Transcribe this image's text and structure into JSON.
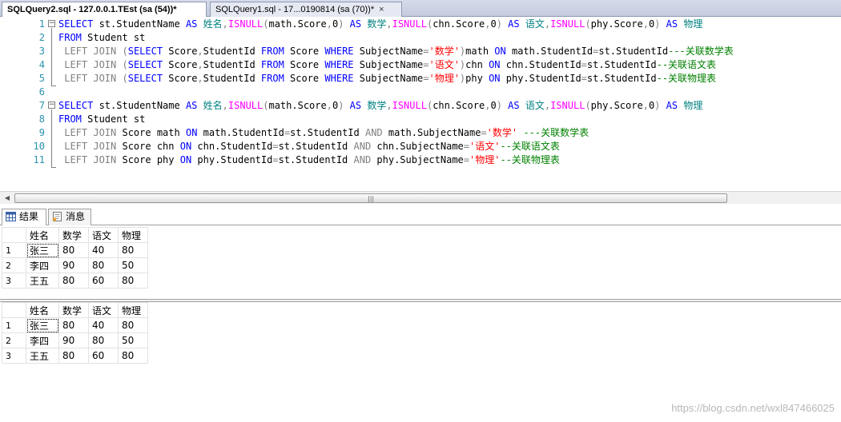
{
  "tabs": [
    {
      "label": "SQLQuery2.sql - 127.0.0.1.TEst (sa (54))*",
      "active": true
    },
    {
      "label": "SQLQuery1.sql - 17...0190814 (sa (70))*",
      "active": false
    }
  ],
  "tab_close_glyph": "×",
  "editor": {
    "line_numbers": [
      "1",
      "2",
      "3",
      "4",
      "5",
      "6",
      "7",
      "8",
      "9",
      "10",
      "11"
    ],
    "lines": [
      [
        [
          "kw",
          "SELECT "
        ],
        [
          "pl",
          "st.StudentName "
        ],
        [
          "kw",
          "AS "
        ],
        [
          "id",
          "姓名"
        ],
        [
          "op",
          ","
        ],
        [
          "fn",
          "ISNULL"
        ],
        [
          "op",
          "("
        ],
        [
          "pl",
          "math.Score"
        ],
        [
          "op",
          ","
        ],
        [
          "pl",
          "0"
        ],
        [
          "op",
          ") "
        ],
        [
          "kw",
          "AS "
        ],
        [
          "id",
          "数学"
        ],
        [
          "op",
          ","
        ],
        [
          "fn",
          "ISNULL"
        ],
        [
          "op",
          "("
        ],
        [
          "pl",
          "chn.Score"
        ],
        [
          "op",
          ","
        ],
        [
          "pl",
          "0"
        ],
        [
          "op",
          ") "
        ],
        [
          "kw",
          "AS "
        ],
        [
          "id",
          "语文"
        ],
        [
          "op",
          ","
        ],
        [
          "fn",
          "ISNULL"
        ],
        [
          "op",
          "("
        ],
        [
          "pl",
          "phy.Score"
        ],
        [
          "op",
          ","
        ],
        [
          "pl",
          "0"
        ],
        [
          "op",
          ") "
        ],
        [
          "kw",
          "AS "
        ],
        [
          "id",
          "物理"
        ]
      ],
      [
        [
          "kw",
          "FROM "
        ],
        [
          "pl",
          "Student st"
        ]
      ],
      [
        [
          "op",
          " LEFT JOIN "
        ],
        [
          "op",
          "("
        ],
        [
          "kw",
          "SELECT "
        ],
        [
          "pl",
          "Score"
        ],
        [
          "op",
          ","
        ],
        [
          "pl",
          "StudentId "
        ],
        [
          "kw",
          "FROM "
        ],
        [
          "pl",
          "Score "
        ],
        [
          "kw",
          "WHERE "
        ],
        [
          "pl",
          "SubjectName"
        ],
        [
          "op",
          "="
        ],
        [
          "str",
          "'数学'"
        ],
        [
          "op",
          ")"
        ],
        [
          "pl",
          "math "
        ],
        [
          "kw",
          "ON "
        ],
        [
          "pl",
          "math.StudentId"
        ],
        [
          "op",
          "="
        ],
        [
          "pl",
          "st.StudentId"
        ],
        [
          "cm",
          "---关联数学表"
        ]
      ],
      [
        [
          "op",
          " LEFT JOIN "
        ],
        [
          "op",
          "("
        ],
        [
          "kw",
          "SELECT "
        ],
        [
          "pl",
          "Score"
        ],
        [
          "op",
          ","
        ],
        [
          "pl",
          "StudentId "
        ],
        [
          "kw",
          "FROM "
        ],
        [
          "pl",
          "Score "
        ],
        [
          "kw",
          "WHERE "
        ],
        [
          "pl",
          "SubjectName"
        ],
        [
          "op",
          "="
        ],
        [
          "str",
          "'语文'"
        ],
        [
          "op",
          ")"
        ],
        [
          "pl",
          "chn "
        ],
        [
          "kw",
          "ON "
        ],
        [
          "pl",
          "chn.StudentId"
        ],
        [
          "op",
          "="
        ],
        [
          "pl",
          "st.StudentId"
        ],
        [
          "cm",
          "--关联语文表"
        ]
      ],
      [
        [
          "op",
          " LEFT JOIN "
        ],
        [
          "op",
          "("
        ],
        [
          "kw",
          "SELECT "
        ],
        [
          "pl",
          "Score"
        ],
        [
          "op",
          ","
        ],
        [
          "pl",
          "StudentId "
        ],
        [
          "kw",
          "FROM "
        ],
        [
          "pl",
          "Score "
        ],
        [
          "kw",
          "WHERE "
        ],
        [
          "pl",
          "SubjectName"
        ],
        [
          "op",
          "="
        ],
        [
          "str",
          "'物理'"
        ],
        [
          "op",
          ")"
        ],
        [
          "pl",
          "phy "
        ],
        [
          "kw",
          "ON "
        ],
        [
          "pl",
          "phy.StudentId"
        ],
        [
          "op",
          "="
        ],
        [
          "pl",
          "st.StudentId"
        ],
        [
          "cm",
          "--关联物理表"
        ]
      ],
      [],
      [
        [
          "kw",
          "SELECT "
        ],
        [
          "pl",
          "st.StudentName "
        ],
        [
          "kw",
          "AS "
        ],
        [
          "id",
          "姓名"
        ],
        [
          "op",
          ","
        ],
        [
          "fn",
          "ISNULL"
        ],
        [
          "op",
          "("
        ],
        [
          "pl",
          "math.Score"
        ],
        [
          "op",
          ","
        ],
        [
          "pl",
          "0"
        ],
        [
          "op",
          ") "
        ],
        [
          "kw",
          "AS "
        ],
        [
          "id",
          "数学"
        ],
        [
          "op",
          ","
        ],
        [
          "fn",
          "ISNULL"
        ],
        [
          "op",
          "("
        ],
        [
          "pl",
          "chn.Score"
        ],
        [
          "op",
          ","
        ],
        [
          "pl",
          "0"
        ],
        [
          "op",
          ") "
        ],
        [
          "kw",
          "AS "
        ],
        [
          "id",
          "语文"
        ],
        [
          "op",
          ","
        ],
        [
          "fn",
          "ISNULL"
        ],
        [
          "op",
          "("
        ],
        [
          "pl",
          "phy.Score"
        ],
        [
          "op",
          ","
        ],
        [
          "pl",
          "0"
        ],
        [
          "op",
          ") "
        ],
        [
          "kw",
          "AS "
        ],
        [
          "id",
          "物理"
        ]
      ],
      [
        [
          "kw",
          "FROM "
        ],
        [
          "pl",
          "Student st"
        ]
      ],
      [
        [
          "op",
          " LEFT JOIN "
        ],
        [
          "pl",
          "Score math "
        ],
        [
          "kw",
          "ON "
        ],
        [
          "pl",
          "math.StudentId"
        ],
        [
          "op",
          "="
        ],
        [
          "pl",
          "st.StudentId "
        ],
        [
          "op",
          "AND "
        ],
        [
          "pl",
          "math.SubjectName"
        ],
        [
          "op",
          "="
        ],
        [
          "str",
          "'数学' "
        ],
        [
          "cm",
          "---关联数学表"
        ]
      ],
      [
        [
          "op",
          " LEFT JOIN "
        ],
        [
          "pl",
          "Score chn "
        ],
        [
          "kw",
          "ON "
        ],
        [
          "pl",
          "chn.StudentId"
        ],
        [
          "op",
          "="
        ],
        [
          "pl",
          "st.StudentId "
        ],
        [
          "op",
          "AND "
        ],
        [
          "pl",
          "chn.SubjectName"
        ],
        [
          "op",
          "="
        ],
        [
          "str",
          "'语文'"
        ],
        [
          "cm",
          "--关联语文表"
        ]
      ],
      [
        [
          "op",
          " LEFT JOIN "
        ],
        [
          "pl",
          "Score phy "
        ],
        [
          "kw",
          "ON "
        ],
        [
          "pl",
          "phy.StudentId"
        ],
        [
          "op",
          "="
        ],
        [
          "pl",
          "st.StudentId "
        ],
        [
          "op",
          "AND "
        ],
        [
          "pl",
          "phy.SubjectName"
        ],
        [
          "op",
          "="
        ],
        [
          "str",
          "'物理'"
        ],
        [
          "cm",
          "--关联物理表"
        ]
      ]
    ]
  },
  "scrollbar": {
    "left_arrow": "◀",
    "grip": "|||"
  },
  "result_tabs": {
    "results_label": "结果",
    "messages_label": "消息",
    "results_icon": "grid-icon",
    "messages_icon": "message-icon"
  },
  "grid_columns": [
    "姓名",
    "数学",
    "语文",
    "物理"
  ],
  "result_sets": [
    {
      "rows": [
        [
          "1",
          "张三",
          "80",
          "40",
          "80"
        ],
        [
          "2",
          "李四",
          "90",
          "80",
          "50"
        ],
        [
          "3",
          "王五",
          "80",
          "60",
          "80"
        ]
      ]
    },
    {
      "rows": [
        [
          "1",
          "张三",
          "80",
          "40",
          "80"
        ],
        [
          "2",
          "李四",
          "90",
          "80",
          "50"
        ],
        [
          "3",
          "王五",
          "80",
          "60",
          "80"
        ]
      ]
    }
  ],
  "watermark": "https://blog.csdn.net/wxl847466025",
  "colors": {
    "keyword": "#0000ff",
    "function": "#ff00ff",
    "operator": "#808080",
    "string": "#ff0000",
    "comment": "#008000",
    "alias": "#008080"
  }
}
